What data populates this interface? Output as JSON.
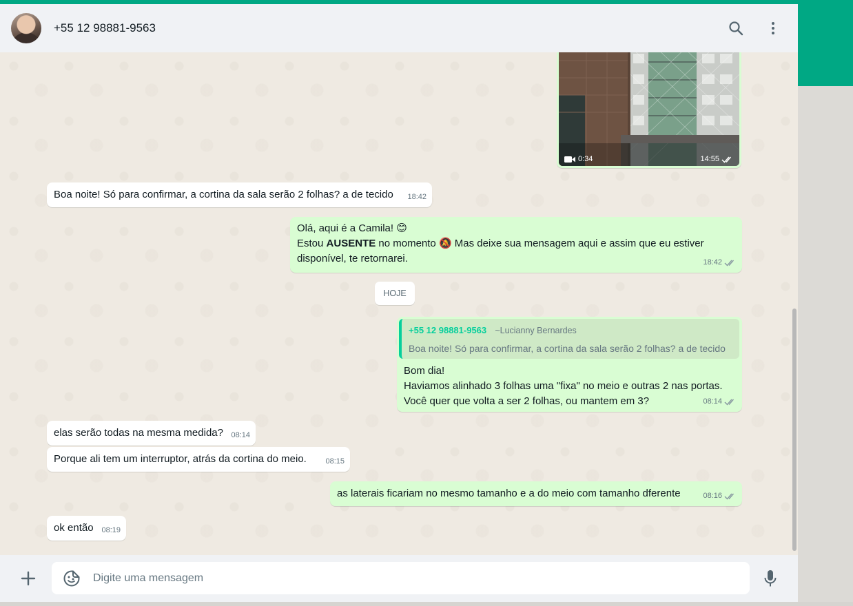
{
  "header": {
    "contact_name": "+55 12 98881-9563",
    "icons": [
      "search-icon",
      "menu-dots-icon"
    ]
  },
  "colors": {
    "accent": "#00a884",
    "outgoing_bubble": "#d9fdd3",
    "incoming_bubble": "#ffffff",
    "chat_background": "#efeae2"
  },
  "messages": {
    "video": {
      "duration": "0:34",
      "time": "14:55"
    },
    "m1": {
      "text": "Boa noite! Só para confirmar, a cortina da sala serão 2 folhas? a de tecido",
      "time": "18:42"
    },
    "m2": {
      "line1": "Olá, aqui é a Camila!",
      "emoji1": "😊",
      "line2_prefix": "Estou ",
      "line2_bold": "AUSENTE",
      "line2_middle": " no momento ",
      "emoji2": "🔕",
      "line2_suffix": " Mas deixe sua mensagem aqui e assim que eu estiver",
      "line3": "disponível, te retornarei.",
      "time": "18:42"
    },
    "day_divider": "HOJE",
    "m3": {
      "quote_author": "+55 12 98881-9563",
      "quote_subname": "~Lucianny Bernardes",
      "quote_text": "Boa noite! Só para confirmar, a cortina da sala serão 2 folhas? a de tecido",
      "line1": "Bom dia!",
      "line2": "Haviamos alinhado 3 folhas uma \"fixa\" no meio e outras 2 nas portas.",
      "line3": "Você quer que volta a ser 2 folhas, ou mantem em 3?",
      "time": "08:14"
    },
    "m4": {
      "text": "elas serão todas na mesma medida?",
      "time": "08:14"
    },
    "m5": {
      "text": "Porque ali tem um interruptor, atrás da cortina do meio.",
      "time": "08:15"
    },
    "m6": {
      "text": "as  laterais ficariam no mesmo tamanho e a do meio com tamanho dferente",
      "time": "08:16"
    },
    "m7": {
      "text": "ok então",
      "time": "08:19"
    }
  },
  "composer": {
    "placeholder": "Digite uma mensagem",
    "icons": [
      "plus-icon",
      "sticker-icon",
      "microphone-icon"
    ]
  }
}
